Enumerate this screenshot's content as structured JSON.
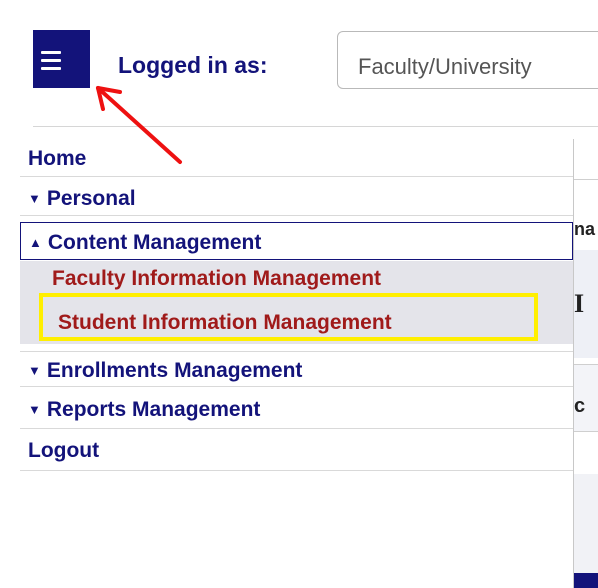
{
  "header": {
    "menu_button_icon": "hamburger-menu-icon",
    "logged_in_label": "Logged in as:",
    "role_select_value": "Faculty/University"
  },
  "sidebar": {
    "items": [
      {
        "label": "Home",
        "caret": ""
      },
      {
        "label": "Personal",
        "caret": "▼"
      },
      {
        "label": "Content Management",
        "caret": "▲"
      },
      {
        "label": "Faculty Information Management"
      },
      {
        "label": "Student Information Management"
      },
      {
        "label": "Enrollments Management",
        "caret": "▼"
      },
      {
        "label": "Reports Management",
        "caret": "▼"
      },
      {
        "label": "Logout",
        "caret": ""
      }
    ]
  },
  "background_fragments": {
    "frag1": "na",
    "frag2": "I",
    "frag3": "c"
  },
  "colors": {
    "nav_text": "#13137a",
    "submenu_text": "#a01a1a",
    "submenu_bg": "#e4e4ea",
    "highlight": "#ffef00",
    "annotation_arrow": "#ee1111"
  }
}
